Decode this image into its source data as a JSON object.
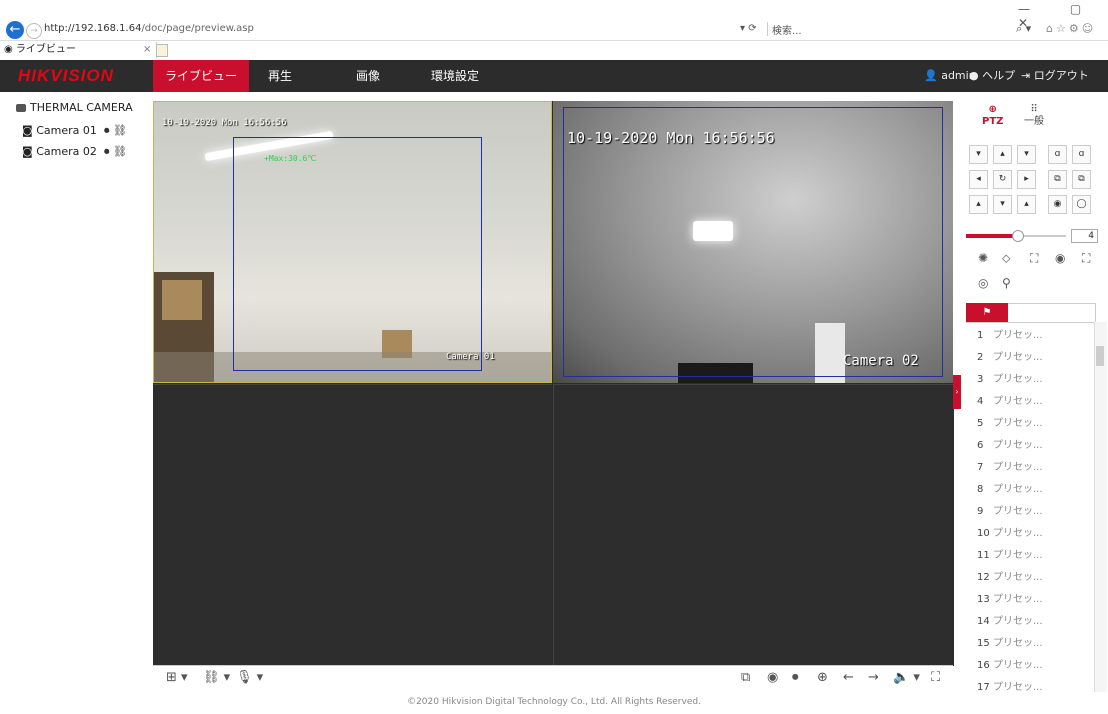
{
  "browser": {
    "url_host": "http://192.168.1.64",
    "url_path": "/doc/page/preview.asp",
    "reload": "▾ ⟳",
    "search_placeholder": "検索...",
    "search_glass": "⌕ ▾",
    "window_controls": "— ▢ ✕",
    "fav_icons": "⌂☆⚙☺",
    "tab_title": "ライブビュー",
    "tab_close": "×"
  },
  "app": {
    "logo": "HIKVISION",
    "nav": [
      "ライブビュー",
      "再生",
      "画像",
      "環境設定"
    ],
    "user": "admin",
    "help": "ヘルプ",
    "logout": "ログアウト"
  },
  "tree": {
    "root": "THERMAL CAMERA",
    "cameras": [
      "Camera 01",
      "Camera 02"
    ],
    "tools": "⏺ ⛓"
  },
  "video": {
    "cell1_time": "10-19-2020 Mon 16:56:56",
    "cell1_max": "+Max:30.6℃",
    "cell1_label": "Camera 01",
    "cell2_time": "10-19-2020 Mon 16:56:56",
    "cell2_label": "Camera 02"
  },
  "toolbar": {
    "left": [
      "⊞ ▾",
      "⛓ ▾",
      "🎙 ▾"
    ],
    "right": [
      "⧉",
      "◉",
      "⏺",
      "⊕",
      "←",
      "→",
      "🔈 ▾",
      "⛶"
    ]
  },
  "ptz": {
    "tab_ptz": "PTZ",
    "tab_general": "一般",
    "speed": "4",
    "directions": [
      "▾",
      "▴",
      "▾",
      "◂",
      "↻",
      "▸",
      "▴",
      "▾",
      "▴"
    ],
    "zoom": [
      "ɑ",
      "ɑ",
      "⧉",
      "⧉",
      "◉",
      "◯"
    ],
    "icons_row1": [
      "✺",
      "⬦",
      "⛶",
      "◉",
      "⛶"
    ],
    "icons_row2": [
      "◎",
      "⚲"
    ],
    "preset_flag": "⚑",
    "preset_label": "プリセッ...",
    "preset_numbers": [
      "1",
      "2",
      "3",
      "4",
      "5",
      "6",
      "7",
      "8",
      "9",
      "10",
      "11",
      "12",
      "13",
      "14",
      "15",
      "16",
      "17"
    ]
  },
  "footer": "©2020 Hikvision Digital Technology Co., Ltd. All Rights Reserved."
}
